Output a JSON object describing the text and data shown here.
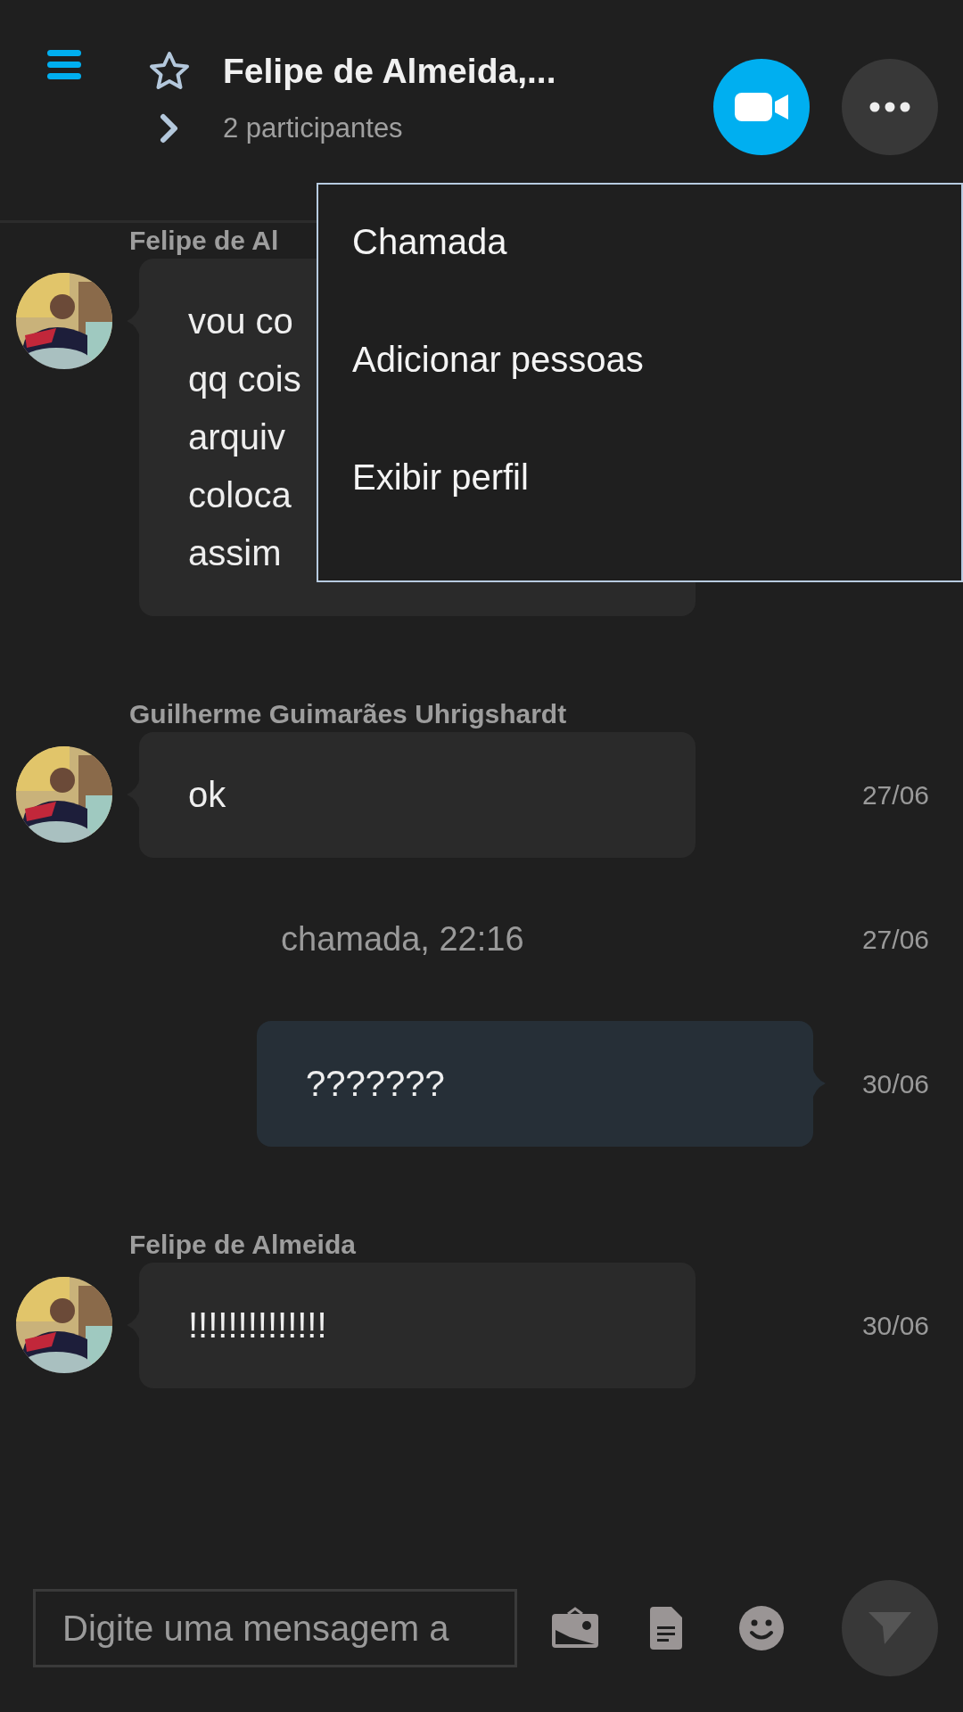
{
  "header": {
    "title": "Felipe de Almeida,...",
    "subtitle": "2 participantes"
  },
  "menu": {
    "items": [
      "Chamada",
      "Adicionar pessoas",
      "Exibir perfil"
    ]
  },
  "messages": [
    {
      "kind": "incoming",
      "sender": "Felipe de Al",
      "lines": [
        "vou co",
        "qq cois",
        "arquiv",
        "coloca",
        "assim"
      ]
    },
    {
      "kind": "incoming",
      "sender": "Guilherme Guimarães Uhrigshardt",
      "lines": [
        "ok"
      ],
      "time": "27/06"
    },
    {
      "kind": "event",
      "text": "chamada, 22:16",
      "time": "27/06"
    },
    {
      "kind": "outgoing",
      "lines": [
        "???????"
      ],
      "time": "30/06"
    },
    {
      "kind": "incoming",
      "sender": "Felipe de Almeida",
      "lines": [
        "!!!!!!!!!!!!!!"
      ],
      "time": "30/06"
    }
  ],
  "composer": {
    "placeholder": "Digite uma mensagem a"
  }
}
